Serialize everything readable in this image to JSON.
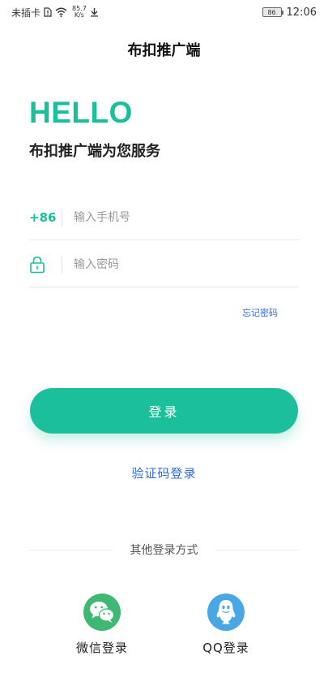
{
  "status_bar": {
    "carrier": "未插卡",
    "speed_value": "85.7",
    "speed_unit": "K/s",
    "battery": "86",
    "time": "12:06"
  },
  "header": {
    "title": "布扣推广端"
  },
  "welcome": {
    "hello": "HELLO",
    "subtitle": "布扣推广端为您服务"
  },
  "form": {
    "phone_prefix": "+86",
    "phone_placeholder": "输入手机号",
    "password_placeholder": "输入密码",
    "forgot_label": "忘记密码"
  },
  "actions": {
    "login_label": "登录",
    "code_login_label": "验证码登录"
  },
  "other_login": {
    "title": "其他登录方式",
    "options": [
      {
        "label": "微信登录",
        "icon": "wechat-icon",
        "color": "#3eb873"
      },
      {
        "label": "QQ登录",
        "icon": "qq-icon",
        "color": "#4aa7e6"
      }
    ]
  },
  "colors": {
    "accent": "#1cbf9b",
    "link": "#2d6cdf"
  }
}
